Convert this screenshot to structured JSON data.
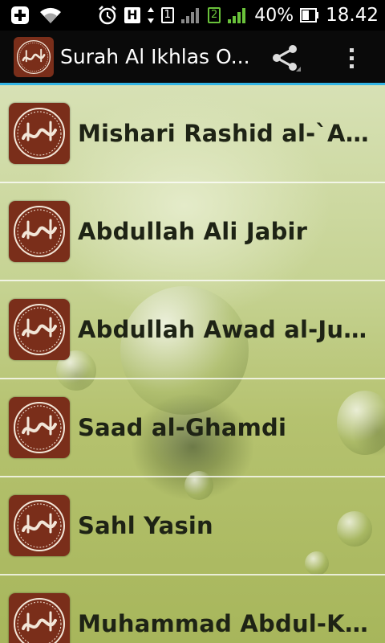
{
  "status_bar": {
    "battery_percent": "40%",
    "time": "18.42",
    "network_type": "H",
    "sim1_label": "1",
    "sim2_label": "2",
    "icons": [
      "add-icon",
      "wifi-icon",
      "alarm-icon",
      "signal-icon",
      "battery-icon"
    ]
  },
  "app_bar": {
    "title": "Surah Al Ikhlas O...",
    "icon": "app-logo-icon",
    "actions": [
      "share-icon",
      "overflow-menu-icon"
    ]
  },
  "reciters": [
    {
      "label": "Mishari Rashid al-`Afasy"
    },
    {
      "label": "Abdullah Ali Jabir"
    },
    {
      "label": "Abdullah Awad al-Juhani"
    },
    {
      "label": "Saad al-Ghamdi"
    },
    {
      "label": "Sahl Yasin"
    },
    {
      "label": "Muhammad Abdul-Kare..."
    }
  ],
  "colors": {
    "accent": "#33b5e5",
    "logo_brown": "#7a2e1a",
    "label_text": "#1e2315"
  }
}
